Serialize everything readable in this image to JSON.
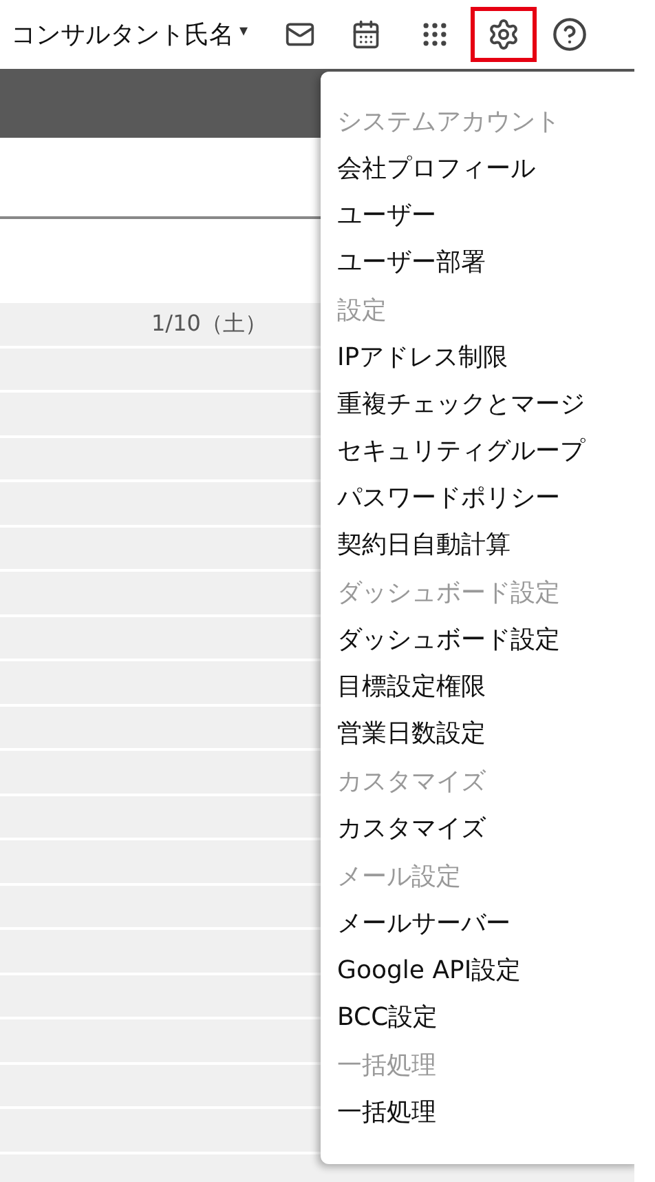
{
  "header": {
    "user_name": "コンサルタント氏名",
    "caret": "▾",
    "settings_highlighted": true
  },
  "calendar": {
    "date_label": "1/10（土）"
  },
  "settings_menu": {
    "sections": [
      {
        "header": "システムアカウント",
        "items": [
          "会社プロフィール",
          "ユーザー",
          "ユーザー部署"
        ]
      },
      {
        "header": "設定",
        "items": [
          "IPアドレス制限",
          "重複チェックとマージ",
          "セキュリティグループ",
          "パスワードポリシー",
          "契約日自動計算"
        ]
      },
      {
        "header": "ダッシュボード設定",
        "items": [
          "ダッシュボード設定",
          "目標設定権限",
          "営業日数設定"
        ]
      },
      {
        "header": "カスタマイズ",
        "items": [
          "カスタマイズ"
        ]
      },
      {
        "header": "メール設定",
        "items": [
          "メールサーバー",
          "Google API設定",
          "BCC設定"
        ]
      },
      {
        "header": "一括処理",
        "items": [
          "一括処理"
        ]
      }
    ]
  }
}
